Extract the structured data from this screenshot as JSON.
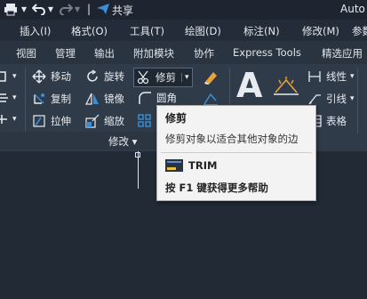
{
  "title_bar": {
    "share_label": "共享",
    "app_title": "Auto"
  },
  "menu_bar": [
    "插入(I)",
    "格式(O)",
    "工具(T)",
    "绘图(D)",
    "标注(N)",
    "修改(M)",
    "参数"
  ],
  "tabs": [
    "视图",
    "管理",
    "输出",
    "附加模块",
    "协作",
    "Express Tools",
    "精选应用"
  ],
  "ribbon": {
    "move": "移动",
    "rotate": "旋转",
    "trim": "修剪",
    "copy": "复制",
    "mirror": "镜像",
    "fillet": "圆角",
    "stretch": "拉伸",
    "scale": "缩放",
    "linetype": "线性",
    "leader": "引线",
    "table": "表格",
    "panel_label": "修改 ▾"
  },
  "tooltip": {
    "title": "修剪",
    "description": "修剪对象以适合其他对象的边",
    "command": "TRIM",
    "help": "按 F1 键获得更多帮助"
  },
  "colors": {
    "accent_blue": "#3a8fd8",
    "ribbon_bg": "#303b49",
    "canvas_bg": "#212a35"
  }
}
